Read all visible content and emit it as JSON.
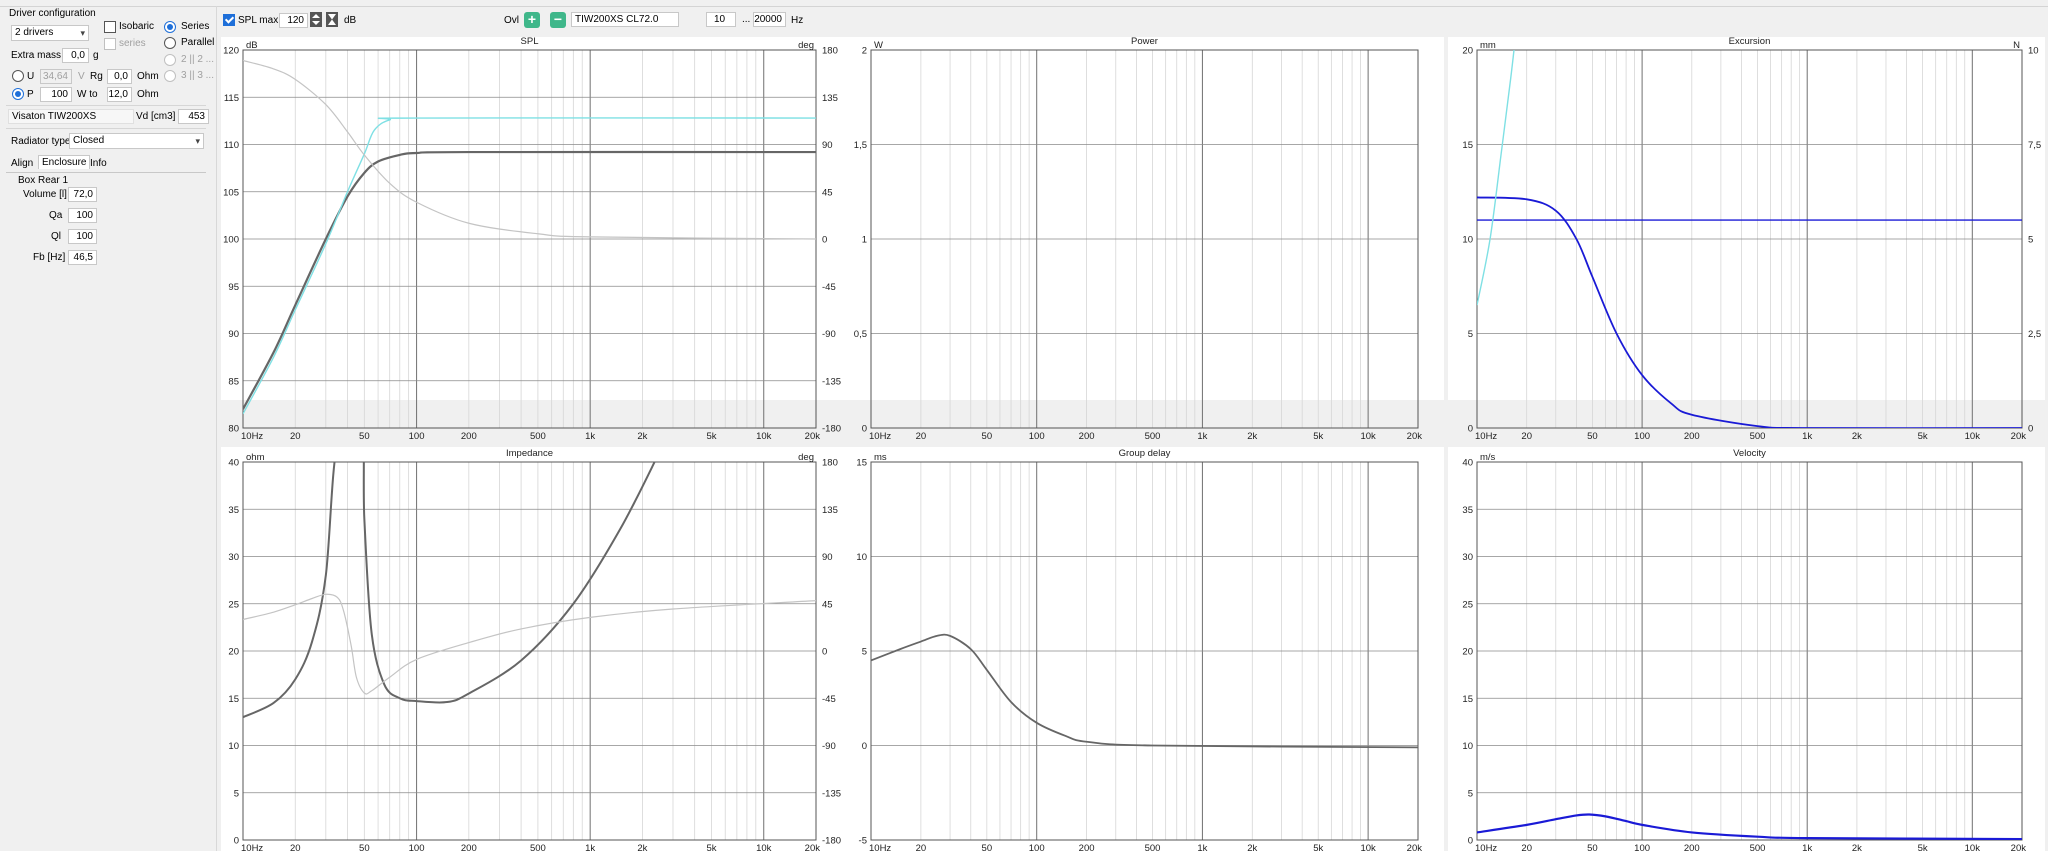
{
  "left_panel": {
    "group_title": "Driver configuration",
    "drivers_select": "2 drivers",
    "isobaric_label": "Isobaric",
    "series_sub_label": "series",
    "series_radio_label": "Series",
    "parallel_radio_label": "Parallel",
    "option_a": "2 || 2 ...",
    "option_b": "3 || 3 ...",
    "extra_mass_label": "Extra mass",
    "extra_mass_value": "0,0",
    "extra_mass_unit": "g",
    "u_label": "U",
    "u_value": "34,64",
    "u_unit": "V",
    "rg_label": "Rg",
    "rg_value": "0,0",
    "rg_unit": "Ohm",
    "p_label": "P",
    "p_value": "100",
    "w_to_label": "W to",
    "w_to_value": "12,0",
    "p_unit": "Ohm",
    "driver_name": "Visaton TIW200XS",
    "vd_label": "Vd [cm3]",
    "vd_value": "453",
    "radiator_label": "Radiator type",
    "radiator_value": "Closed",
    "tabs": [
      "Align",
      "Enclosure",
      "Info"
    ],
    "box_title": "Box Rear 1",
    "volume_label": "Volume [l]",
    "volume_value": "72,0",
    "qa_label": "Qa",
    "qa_value": "100",
    "ql_label": "Ql",
    "ql_value": "100",
    "fb_label": "Fb [Hz]",
    "fb_value": "46,5"
  },
  "toolbar": {
    "spl_max_label": "SPL max",
    "spl_max_value": "120",
    "db_label": "dB",
    "ovl_label": "Ovl",
    "plus_symbol": "+",
    "minus_symbol": "−",
    "project_name": "TIW200XS CL72.0",
    "freq_from": "10",
    "freq_ellipsis": "...",
    "freq_to": "20000",
    "hz_label": "Hz"
  },
  "colors": {
    "gray_curve": "#666666",
    "light_curve": "#c4c4c4",
    "cyan_curve": "#7fe0e4",
    "blue_curve": "#1a1ad6"
  },
  "x_ticks": [
    "10Hz",
    "20",
    "50",
    "100",
    "200",
    "500",
    "1k",
    "2k",
    "5k",
    "10k",
    "20k"
  ],
  "chart_data": [
    {
      "type": "line",
      "title": "SPL",
      "y_unit": "dB",
      "y2_unit": "deg",
      "y_ticks": [
        "120",
        "115",
        "110",
        "105",
        "100",
        "95",
        "90",
        "85",
        "80"
      ],
      "y2_ticks": [
        "180",
        "135",
        "90",
        "45",
        "0",
        "-45",
        "-90",
        "-135",
        "-180"
      ],
      "ylim": [
        80,
        120
      ],
      "y2lim": [
        -180,
        180
      ],
      "xlim": [
        10,
        20000
      ],
      "xscale": "log",
      "series": [
        {
          "color": "#666666",
          "axis": "left",
          "width": 2.2,
          "points": [
            [
              10,
              82
            ],
            [
              15,
              88
            ],
            [
              20,
              93
            ],
            [
              30,
              100
            ],
            [
              40,
              104.5
            ],
            [
              50,
              107
            ],
            [
              60,
              108.2
            ],
            [
              80,
              108.9
            ],
            [
              100,
              109.1
            ],
            [
              200,
              109.2
            ],
            [
              20000,
              109.2
            ]
          ]
        },
        {
          "color": "#7fe0e4",
          "axis": "left",
          "width": 1.4,
          "points": [
            [
              10,
              81.5
            ],
            [
              15,
              87.5
            ],
            [
              20,
              92.5
            ],
            [
              30,
              99.5
            ],
            [
              40,
              105
            ],
            [
              50,
              109
            ],
            [
              57,
              111.5
            ],
            [
              70,
              112.6
            ],
            [
              100,
              112.8
            ],
            [
              20000,
              112.8
            ]
          ]
        },
        {
          "color": "#c4c4c4",
          "axis": "right",
          "width": 1.2,
          "points": [
            [
              10,
              170
            ],
            [
              15,
              162
            ],
            [
              20,
              152
            ],
            [
              30,
              128
            ],
            [
              40,
              102
            ],
            [
              50,
              80
            ],
            [
              70,
              53
            ],
            [
              100,
              35
            ],
            [
              200,
              15
            ],
            [
              500,
              5
            ],
            [
              1000,
              2
            ],
            [
              20000,
              0
            ]
          ]
        }
      ]
    },
    {
      "type": "line",
      "title": "Power",
      "y_unit": "W",
      "y_ticks": [
        "2",
        "1,5",
        "1",
        "0,5",
        "0"
      ],
      "ylim": [
        0,
        2
      ],
      "xlim": [
        10,
        20000
      ],
      "xscale": "log",
      "series": []
    },
    {
      "type": "line",
      "title": "Excursion",
      "y_unit": "mm",
      "y2_unit": "N",
      "y_ticks": [
        "20",
        "15",
        "10",
        "5",
        "0"
      ],
      "y2_ticks": [
        "10",
        "7,5",
        "5",
        "2,5",
        "0"
      ],
      "ylim": [
        0,
        20
      ],
      "y2lim": [
        0,
        10
      ],
      "xlim": [
        10,
        20000
      ],
      "xscale": "log",
      "series": [
        {
          "color": "#1a1ad6",
          "axis": "left",
          "width": 1.8,
          "points": [
            [
              10,
              12.2
            ],
            [
              20,
              12.1
            ],
            [
              30,
              11.5
            ],
            [
              40,
              10
            ],
            [
              50,
              8
            ],
            [
              70,
              5
            ],
            [
              100,
              2.8
            ],
            [
              150,
              1.3
            ],
            [
              200,
              0.7
            ],
            [
              500,
              0.1
            ],
            [
              1000,
              0
            ],
            [
              20000,
              0
            ]
          ]
        },
        {
          "color": "#1a1ad6",
          "axis": "left",
          "width": 1.4,
          "points": [
            [
              10,
              11
            ],
            [
              20000,
              11
            ]
          ]
        },
        {
          "color": "#7fe0e4",
          "axis": "left",
          "width": 1.4,
          "points": [
            [
              10,
              6.5
            ],
            [
              12,
              10
            ],
            [
              14,
              14.5
            ],
            [
              16,
              18.5
            ],
            [
              17,
              20.5
            ]
          ]
        }
      ]
    },
    {
      "type": "line",
      "title": "Impedance",
      "y_unit": "ohm",
      "y2_unit": "deg",
      "y_ticks": [
        "40",
        "35",
        "30",
        "25",
        "20",
        "15",
        "10",
        "5",
        "0"
      ],
      "y2_ticks": [
        "180",
        "135",
        "90",
        "45",
        "0",
        "-45",
        "-90",
        "-135",
        "-180"
      ],
      "ylim": [
        0,
        40
      ],
      "y2lim": [
        -180,
        180
      ],
      "xlim": [
        10,
        20000
      ],
      "xscale": "log",
      "series": [
        {
          "color": "#666666",
          "axis": "left",
          "width": 2,
          "points": [
            [
              10,
              13
            ],
            [
              15,
              14.5
            ],
            [
              20,
              17
            ],
            [
              25,
              21
            ],
            [
              30,
              28
            ],
            [
              35,
              42
            ],
            [
              48,
              44
            ],
            [
              50,
              34
            ],
            [
              55,
              22
            ],
            [
              65,
              16.5
            ],
            [
              80,
              15
            ],
            [
              100,
              14.7
            ],
            [
              150,
              14.6
            ],
            [
              200,
              15.5
            ],
            [
              400,
              19
            ],
            [
              800,
              25
            ],
            [
              1500,
              33
            ],
            [
              2500,
              41
            ]
          ]
        },
        {
          "color": "#c4c4c4",
          "axis": "right",
          "width": 1.2,
          "points": [
            [
              10,
              30
            ],
            [
              15,
              37
            ],
            [
              20,
              44
            ],
            [
              25,
              50
            ],
            [
              30,
              54
            ],
            [
              35,
              51
            ],
            [
              38,
              38
            ],
            [
              42,
              5
            ],
            [
              45,
              -25
            ],
            [
              50,
              -40
            ],
            [
              55,
              -38
            ],
            [
              70,
              -25
            ],
            [
              100,
              -8
            ],
            [
              200,
              8
            ],
            [
              400,
              21
            ],
            [
              1000,
              32
            ],
            [
              3000,
              40
            ],
            [
              20000,
              48
            ]
          ]
        }
      ]
    },
    {
      "type": "line",
      "title": "Group delay",
      "y_unit": "ms",
      "y_ticks": [
        "15",
        "10",
        "5",
        "0",
        "-5"
      ],
      "ylim": [
        -5,
        15
      ],
      "xlim": [
        10,
        20000
      ],
      "xscale": "log",
      "series": [
        {
          "color": "#666666",
          "axis": "left",
          "width": 1.8,
          "points": [
            [
              10,
              4.5
            ],
            [
              15,
              5.1
            ],
            [
              20,
              5.5
            ],
            [
              25,
              5.8
            ],
            [
              30,
              5.8
            ],
            [
              40,
              5.1
            ],
            [
              50,
              4
            ],
            [
              70,
              2.3
            ],
            [
              100,
              1.2
            ],
            [
              150,
              0.5
            ],
            [
              200,
              0.2
            ],
            [
              500,
              0
            ],
            [
              20000,
              -0.1
            ]
          ]
        }
      ]
    },
    {
      "type": "line",
      "title": "Velocity",
      "y_unit": "m/s",
      "y_ticks": [
        "40",
        "35",
        "30",
        "25",
        "20",
        "15",
        "10",
        "5",
        "0"
      ],
      "ylim": [
        0,
        40
      ],
      "xlim": [
        10,
        20000
      ],
      "xscale": "log",
      "series": [
        {
          "color": "#1a1ad6",
          "axis": "left",
          "width": 2.2,
          "points": [
            [
              10,
              0.8
            ],
            [
              20,
              1.6
            ],
            [
              30,
              2.2
            ],
            [
              40,
              2.6
            ],
            [
              48,
              2.7
            ],
            [
              60,
              2.5
            ],
            [
              80,
              2
            ],
            [
              100,
              1.6
            ],
            [
              200,
              0.8
            ],
            [
              500,
              0.35
            ],
            [
              1000,
              0.2
            ],
            [
              20000,
              0.1
            ]
          ]
        }
      ]
    }
  ]
}
